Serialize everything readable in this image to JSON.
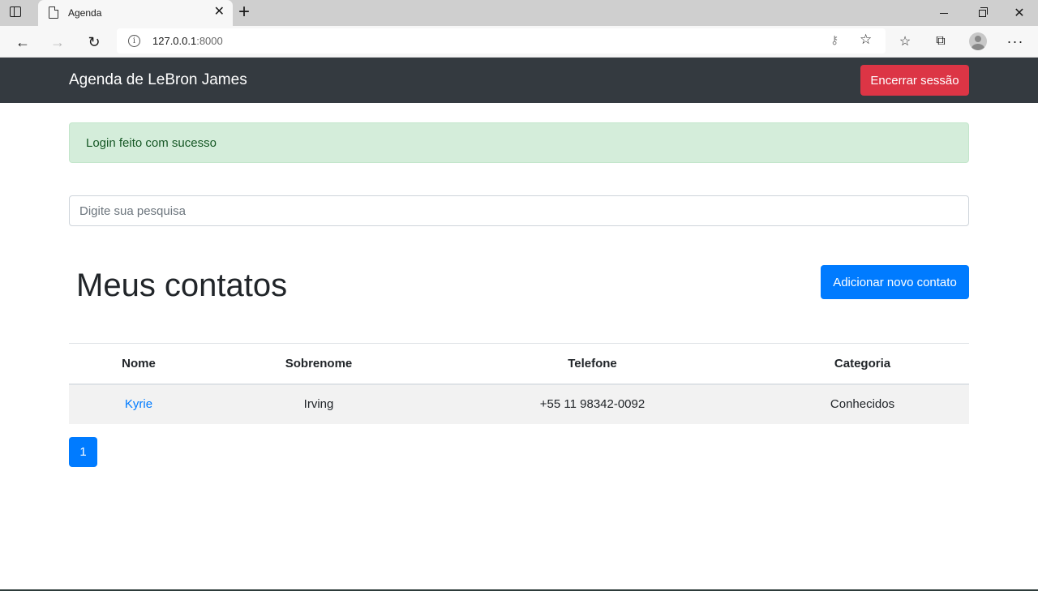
{
  "browser": {
    "tab_title": "Agenda",
    "url_host": "127.0.0.1",
    "url_port": ":8000"
  },
  "navbar": {
    "brand": "Agenda de LeBron James",
    "logout_label": "Encerrar sessão"
  },
  "alert": {
    "message": "Login feito com sucesso"
  },
  "search": {
    "placeholder": "Digite sua pesquisa"
  },
  "contacts": {
    "title": "Meus contatos",
    "add_label": "Adicionar novo contato",
    "headers": [
      "Nome",
      "Sobrenome",
      "Telefone",
      "Categoria"
    ],
    "rows": [
      {
        "nome": "Kyrie",
        "sobrenome": "Irving",
        "telefone": "+55 11 98342-0092",
        "categoria": "Conhecidos"
      }
    ]
  },
  "pagination": {
    "current_page": "1"
  },
  "colors": {
    "navbar_bg": "#343a40",
    "danger": "#dc3545",
    "primary": "#007bff",
    "success_bg": "#d4edda",
    "success_text": "#155724"
  }
}
